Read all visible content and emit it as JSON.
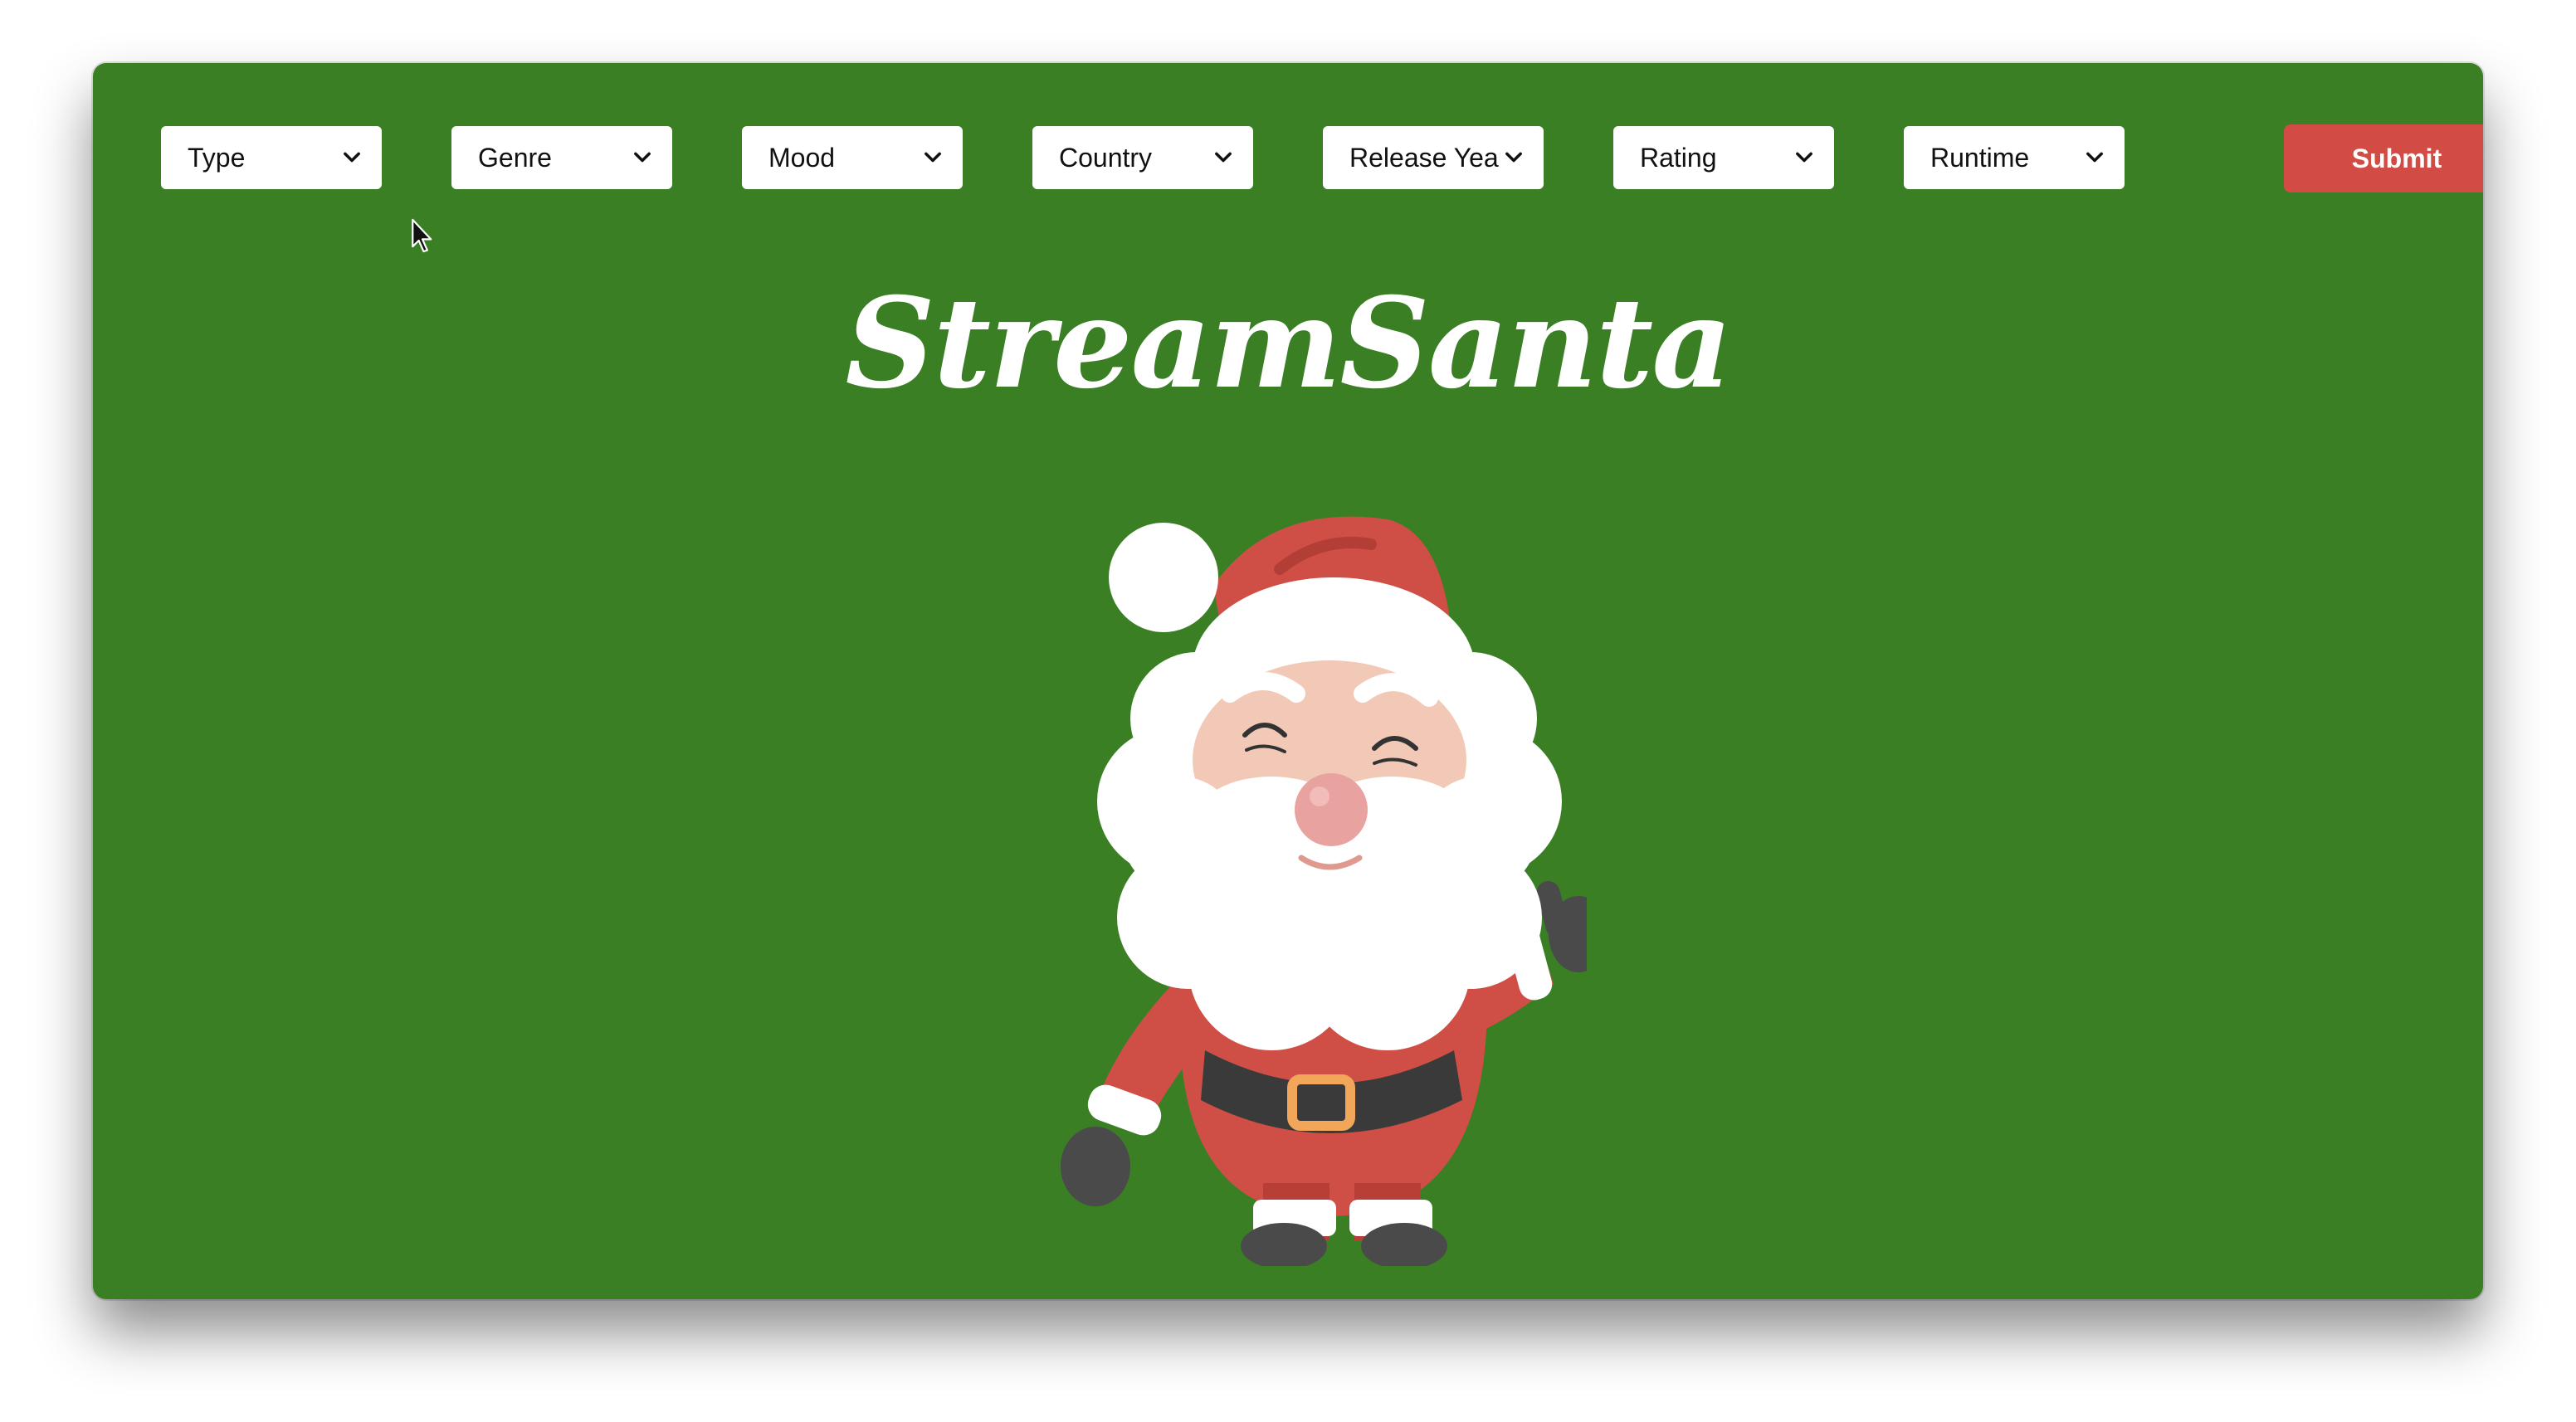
{
  "app": {
    "title": "StreamSanta"
  },
  "filters": [
    {
      "label": "Type",
      "name": "type"
    },
    {
      "label": "Genre",
      "name": "genre"
    },
    {
      "label": "Mood",
      "name": "mood"
    },
    {
      "label": "Country",
      "name": "country"
    },
    {
      "label": "Release Year",
      "name": "release-year"
    },
    {
      "label": "Rating",
      "name": "rating"
    },
    {
      "label": "Runtime",
      "name": "runtime"
    }
  ],
  "submit": {
    "label": "Submit"
  },
  "icons": {
    "chevron": "chevron-down-icon",
    "mascot": "santa-illustration",
    "pointer": "mouse-pointer-icon"
  },
  "colors": {
    "background": "#3a7f24",
    "submit": "#d24b45",
    "select_bg": "#ffffff",
    "title": "#ffffff"
  }
}
